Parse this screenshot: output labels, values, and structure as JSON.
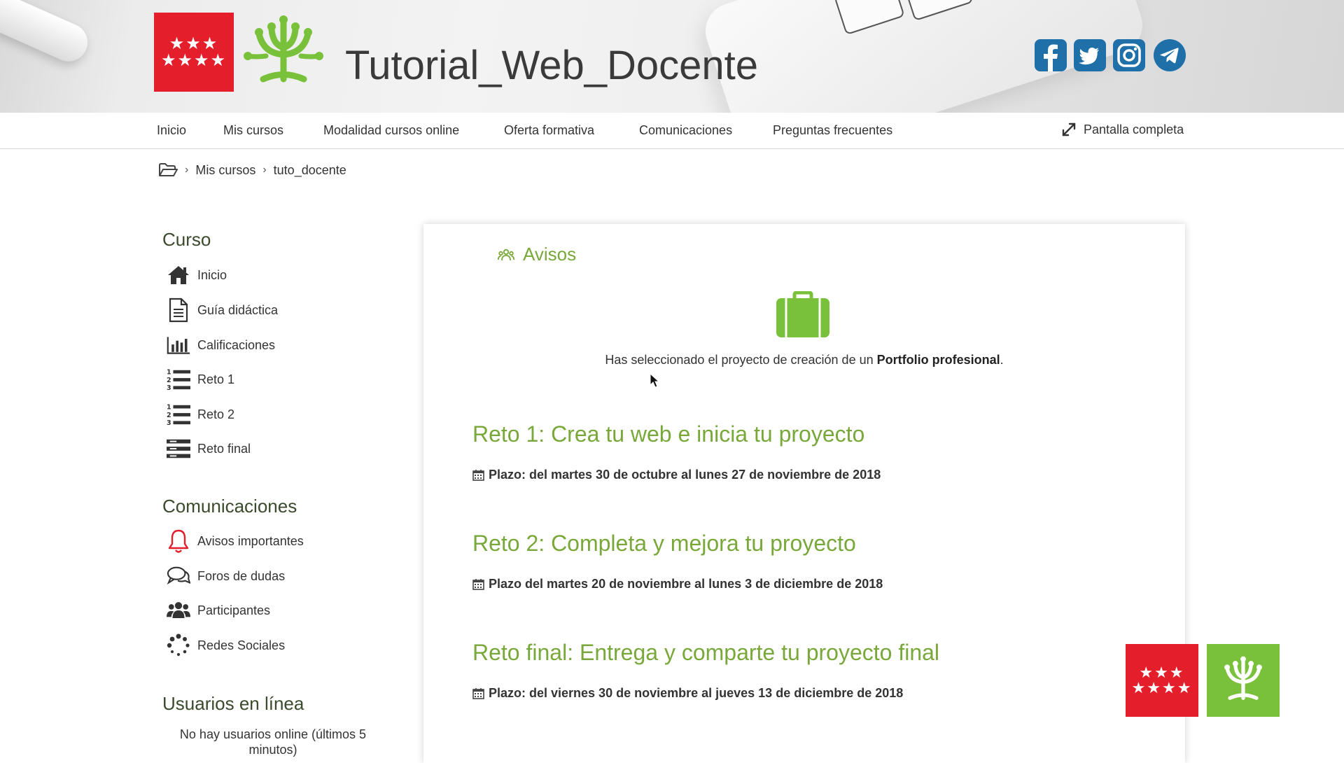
{
  "header": {
    "site_title": "Tutorial_Web_Docente",
    "logo_stars_row1": "★★★",
    "logo_stars_row2": "★★★★",
    "social": [
      "facebook-icon",
      "twitter-icon",
      "instagram-icon",
      "telegram-icon"
    ]
  },
  "nav": {
    "items": [
      "Inicio",
      "Mis cursos",
      "Modalidad cursos online",
      "Oferta formativa",
      "Comunicaciones",
      "Preguntas frecuentes"
    ],
    "fullscreen_label": "Pantalla completa"
  },
  "breadcrumb": {
    "items": [
      "Mis cursos",
      "tuto_docente"
    ],
    "separator": "›"
  },
  "sidebar": {
    "curso_title": "Curso",
    "curso_items": [
      {
        "label": "Inicio",
        "icon": "home-icon"
      },
      {
        "label": "Guía didáctica",
        "icon": "document-icon"
      },
      {
        "label": "Calificaciones",
        "icon": "bar-chart-icon"
      },
      {
        "label": "Reto 1",
        "icon": "numbered-list-icon"
      },
      {
        "label": "Reto 2",
        "icon": "numbered-list-icon"
      },
      {
        "label": "Reto final",
        "icon": "list-icon"
      }
    ],
    "comunicaciones_title": "Comunicaciones",
    "comunicaciones_items": [
      {
        "label": "Avisos importantes",
        "icon": "bell-icon"
      },
      {
        "label": "Foros de dudas",
        "icon": "chat-icon"
      },
      {
        "label": "Participantes",
        "icon": "users-icon"
      },
      {
        "label": "Redes Sociales",
        "icon": "spinner-icon"
      }
    ],
    "usuarios_title": "Usuarios en línea",
    "usuarios_text": "No hay usuarios online (últimos 5 minutos)"
  },
  "main": {
    "avisos_title": "Avisos",
    "selected_prefix": "Has seleccionado el proyecto de creación de un ",
    "selected_bold": "Portfolio profesional",
    "selected_suffix": ".",
    "retos": [
      {
        "title": "Reto 1: Crea tu web e inicia tu proyecto",
        "plazo": "Plazo: del martes 30 de octubre al lunes 27 de noviembre de 2018"
      },
      {
        "title": "Reto 2: Completa y mejora tu proyecto",
        "plazo": "Plazo del martes 20 de noviembre al lunes 3 de diciembre de 2018"
      },
      {
        "title": "Reto final: Entrega y comparte tu proyecto final",
        "plazo": "Plazo: del viernes 30 de noviembre al jueves 13 de diciembre de 2018"
      }
    ]
  },
  "colors": {
    "brand_red": "#e41e2b",
    "brand_green": "#79c13a",
    "heading_green": "#79a83a",
    "social_blue": "#1f6fa8"
  }
}
